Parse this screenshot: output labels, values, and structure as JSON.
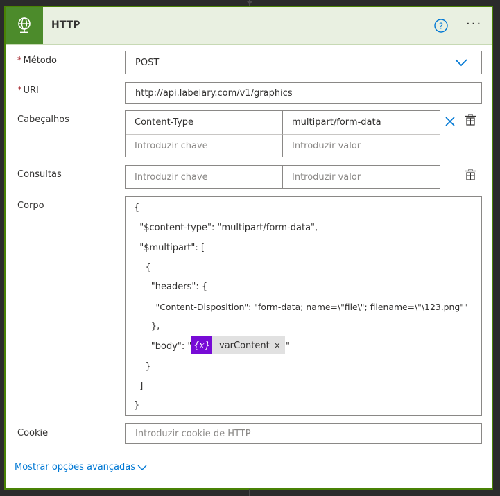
{
  "header": {
    "title": "HTTP",
    "icons": {
      "main": "globe-icon",
      "help": "help-icon",
      "more": "more-icon"
    },
    "more_glyph": "···"
  },
  "form": {
    "method": {
      "label": "Método",
      "required_mark": "*",
      "value": "POST"
    },
    "uri": {
      "label": "URI",
      "required_mark": "*",
      "value": "http://api.labelary.com/v1/graphics"
    },
    "headers": {
      "label": "Cabeçalhos",
      "rows": [
        {
          "key": "Content-Type",
          "value": "multipart/form-data"
        }
      ],
      "key_placeholder": "Introduzir chave",
      "value_placeholder": "Introduzir valor"
    },
    "queries": {
      "label": "Consultas",
      "key_placeholder": "Introduzir chave",
      "value_placeholder": "Introduzir valor"
    },
    "body": {
      "label": "Corpo",
      "lines": [
        "{",
        "  \"$content-type\": \"multipart/form-data\",",
        "  \"$multipart\": [",
        "    {",
        "      \"headers\": {",
        "        \"Content-Disposition\": \"form-data; name=\\\"file\\\"; filename=\\\"\\123.png\"\"",
        "      },",
        "      \"body\": \"",
        "    }",
        "  ]",
        "}"
      ],
      "token": {
        "icon_text": "{x}",
        "label": "varContent",
        "close": "×"
      },
      "after_token": "\""
    },
    "cookie": {
      "label": "Cookie",
      "placeholder": "Introduzir cookie de HTTP"
    }
  },
  "advanced_link": "Mostrar opções avançadas",
  "colors": {
    "accent": "#4c8b2b",
    "header_bg": "#e9f0e1",
    "link": "#0078d4",
    "token": "#770bd6",
    "required": "#a4262c"
  }
}
